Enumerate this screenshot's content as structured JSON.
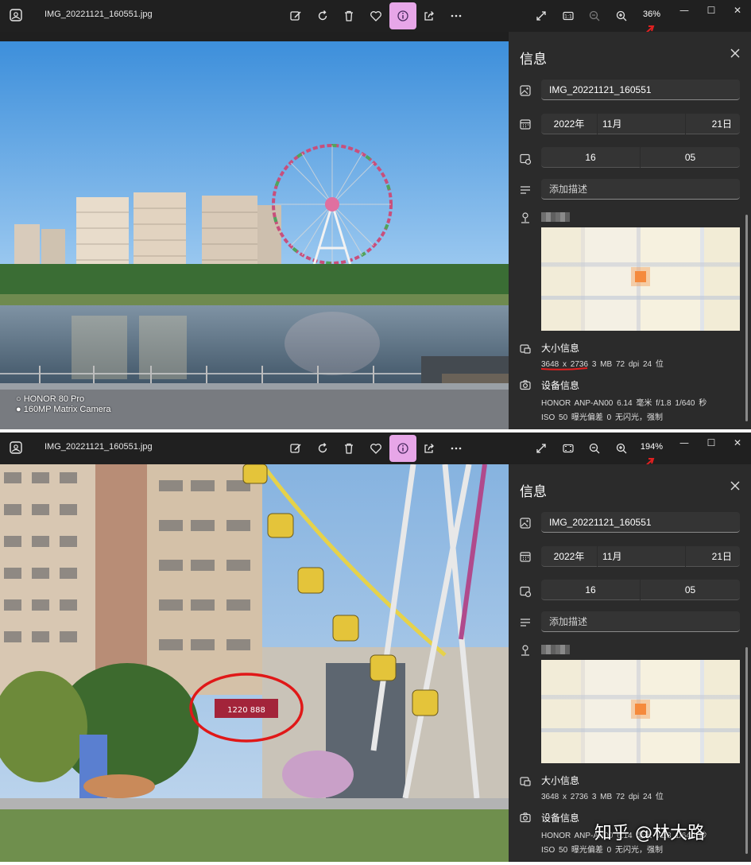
{
  "file_name": "IMG_20221121_160551.jpg",
  "toolbar_icons": [
    "edit-image-icon",
    "rotate-icon",
    "delete-icon",
    "favorite-icon",
    "info-icon",
    "share-icon",
    "more-icon"
  ],
  "window1": {
    "zoom": "36%"
  },
  "window2": {
    "zoom": "194%"
  },
  "window_controls": {
    "minimize": "—",
    "maximize": "☐",
    "close": "✕"
  },
  "info": {
    "title": "信息",
    "name": "IMG_20221121_160551",
    "date": {
      "year": "2022年",
      "month": "11月",
      "day": "21日"
    },
    "time": {
      "hour": "16",
      "minute": "05"
    },
    "description_placeholder": "添加描述",
    "size_title": "大小信息",
    "dimensions": "3648 x 2736",
    "size_rest": "3 MB   72 dpi   24 位",
    "device_title": "设备信息",
    "device_line1": "HONOR   ANP-AN00   6.14 毫米   f/1.8   1/640 秒",
    "device_line2": "ISO 50   曝光偏差 0   无闪光，强制"
  },
  "photo_caption": {
    "line1": "HONOR 80 Pro",
    "line2": "160MP Matrix Camera"
  },
  "zoomed_sign": "1220 888",
  "watermark": "知乎 @林大路",
  "colors": {
    "accent": "#e7a6e8",
    "annotation_red": "#e02020",
    "panel_bg": "#2b2b2b",
    "titlebar_bg": "#202020"
  }
}
